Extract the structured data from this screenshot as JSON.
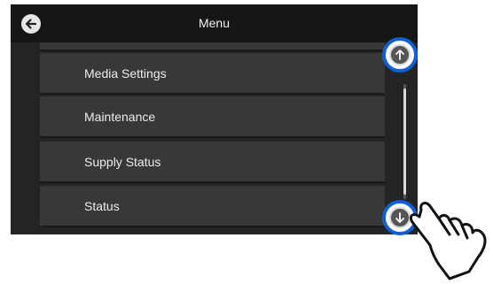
{
  "header": {
    "title": "Menu"
  },
  "menu": {
    "items": [
      {
        "label": "Media Settings"
      },
      {
        "label": "Maintenance"
      },
      {
        "label": "Supply Status"
      },
      {
        "label": "Status"
      }
    ]
  },
  "icons": {
    "back": "back-arrow-icon",
    "scroll_up": "arrow-up-icon",
    "scroll_down": "arrow-down-icon",
    "pointer": "pointing-hand-icon"
  },
  "colors": {
    "highlight_ring": "#0f5fd6",
    "screen_bg": "#242424",
    "item_bg": "#383838"
  }
}
